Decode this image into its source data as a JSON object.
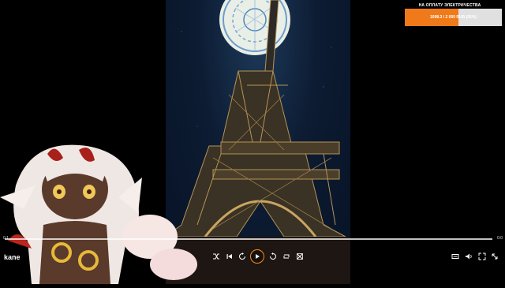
{
  "donation": {
    "title": "НА ОПЛАТУ ЭЛЕКТРИЧЕСТВА",
    "progress_text": "1098.3 / 2 000 RUB (55%)",
    "progress_fraction": 0.55,
    "fill_color": "#f07a1a"
  },
  "player": {
    "channel_label": "kane",
    "time_elapsed": "0:1",
    "time_total": "0:0",
    "progress_fraction": 0.0,
    "accent_color": "#ff8a1f",
    "controls_left": [
      "shuffle-icon",
      "previous-icon",
      "replay-icon",
      "play-icon",
      "repeat-icon",
      "loop-icon",
      "cast-icon"
    ],
    "controls_right": [
      "captions-icon",
      "volume-icon",
      "fullscreen-icon",
      "expand-icon"
    ]
  }
}
